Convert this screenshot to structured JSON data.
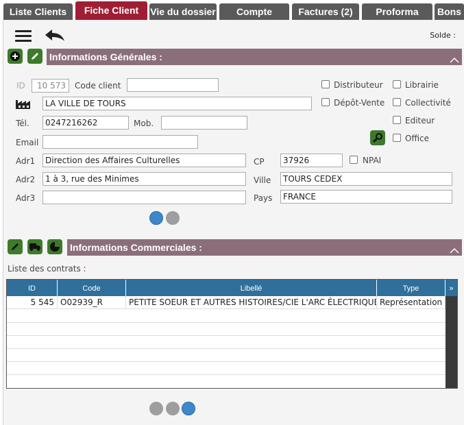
{
  "tabs": [
    {
      "label": "Liste Clients"
    },
    {
      "label": "Fiche Client"
    },
    {
      "label": "Vie du dossier"
    },
    {
      "label": "Compte"
    },
    {
      "label": "Factures (2)"
    },
    {
      "label": "Proforma"
    },
    {
      "label": "Bons d"
    }
  ],
  "toolbar": {
    "solde_label": "Solde :"
  },
  "general": {
    "title": "Informations Générales :",
    "id_label": "ID",
    "id_value": "10 573",
    "code_client_label": "Code client",
    "code_client_value": "",
    "name_value": "LA VILLE DE TOURS",
    "tel_label": "Tél.",
    "tel_value": "0247216262",
    "mob_label": "Mob.",
    "mob_value": "",
    "email_label": "Email",
    "email_value": "",
    "adr1_label": "Adr1",
    "adr1_value": "Direction des Affaires Culturelles",
    "adr2_label": "Adr2",
    "adr2_value": "1 à 3, rue des Minimes",
    "adr3_label": "Adr3",
    "adr3_value": "",
    "cp_label": "CP",
    "cp_value": "37926",
    "npai_label": "NPAI",
    "ville_label": "Ville",
    "ville_value": "TOURS CEDEX",
    "pays_label": "Pays",
    "pays_value": "FRANCE",
    "checkboxes": {
      "distributeur": "Distributeur",
      "librairie": "Librairie",
      "depot_vente": "Dépôt-Vente",
      "collectivite": "Collectivité",
      "editeur": "Editeur",
      "office": "Office"
    }
  },
  "commercial": {
    "title": "Informations Commerciales :",
    "contracts_label": "Liste des contrats :",
    "columns": [
      "ID",
      "Code",
      "Libellé",
      "Type"
    ],
    "rows": [
      {
        "id": "5 545",
        "code": "O02939_R",
        "libelle": "PETITE SOEUR ET AUTRES HISTOIRES/CIE L'ARC ÉLECTRIQUE",
        "type": "Représentation"
      }
    ]
  },
  "colors": {
    "active_tab": "#a01e34",
    "tab": "#5a5a5a",
    "section_bar": "#8a6f7a",
    "grid_header": "#2f6f9a",
    "green_button": "#3d7a2b",
    "page_dot_active": "#3e87c9"
  }
}
